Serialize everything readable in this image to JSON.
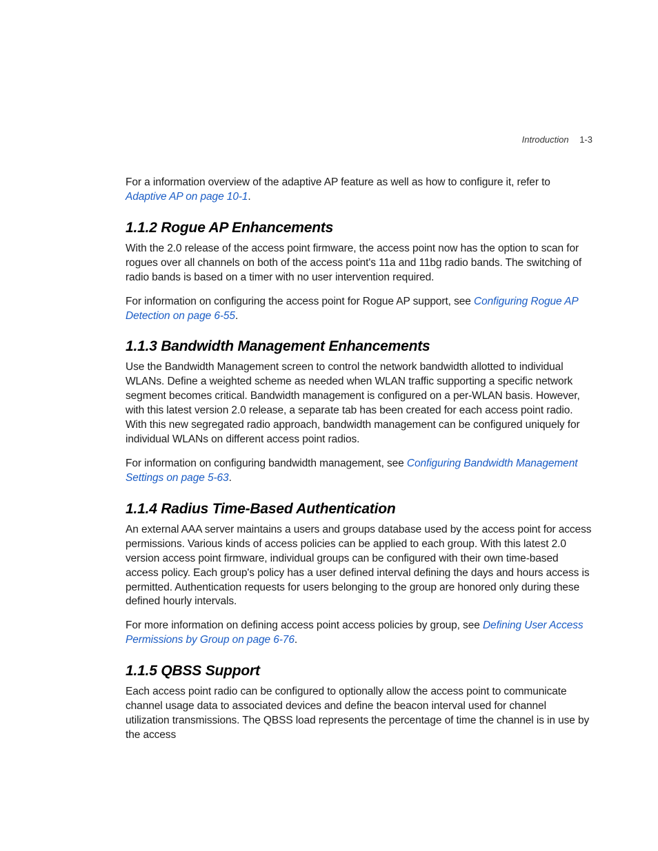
{
  "header": {
    "section": "Introduction",
    "page": "1-3"
  },
  "intro": {
    "p1_a": "For a information overview of the adaptive AP feature as well as how to configure it, refer to ",
    "p1_link": "Adaptive AP on page 10-1",
    "p1_b": "."
  },
  "s112": {
    "heading": "1.1.2 Rogue AP Enhancements",
    "p1": "With the 2.0 release of the access point firmware, the access point now has the option to scan for rogues over all channels on both of the access point's 11a and 11bg radio bands. The switching of radio bands is based on a timer with no user intervention required.",
    "p2_a": "For information on configuring the access point for Rogue AP support, see ",
    "p2_link": "Configuring Rogue AP Detection on page 6-55",
    "p2_b": "."
  },
  "s113": {
    "heading": "1.1.3 Bandwidth Management Enhancements",
    "p1": "Use the Bandwidth Management screen to control the network bandwidth allotted to individual WLANs. Define a weighted scheme as needed when WLAN traffic supporting a specific network segment becomes critical. Bandwidth management is configured on a per-WLAN basis. However, with this latest version 2.0 release, a separate tab has been created for each access point radio. With this new segregated radio approach, bandwidth management can be configured uniquely for individual WLANs on different access point radios.",
    "p2_a": "For information on configuring bandwidth management, see ",
    "p2_link": "Configuring Bandwidth Management Settings on page 5-63",
    "p2_b": "."
  },
  "s114": {
    "heading": "1.1.4 Radius Time-Based Authentication",
    "p1": "An external AAA server maintains a users and groups database used by the access point for access permissions. Various kinds of access policies can be applied to each group. With this latest 2.0 version access point firmware, individual groups can be configured with their own time-based access policy. Each group's policy has a user defined interval defining the days and hours access is permitted. Authentication requests for users belonging to the group are honored only during these defined hourly intervals.",
    "p2_a": "For more information on defining access point access policies by group, see ",
    "p2_link": "Defining User Access Permissions by Group on page 6-76",
    "p2_b": "."
  },
  "s115": {
    "heading": "1.1.5 QBSS Support",
    "p1": "Each access point radio can be configured to optionally allow the access point to communicate channel usage data to associated devices and define the beacon interval used for channel utilization transmissions. The QBSS load represents the percentage of time the channel is in use by the access"
  }
}
